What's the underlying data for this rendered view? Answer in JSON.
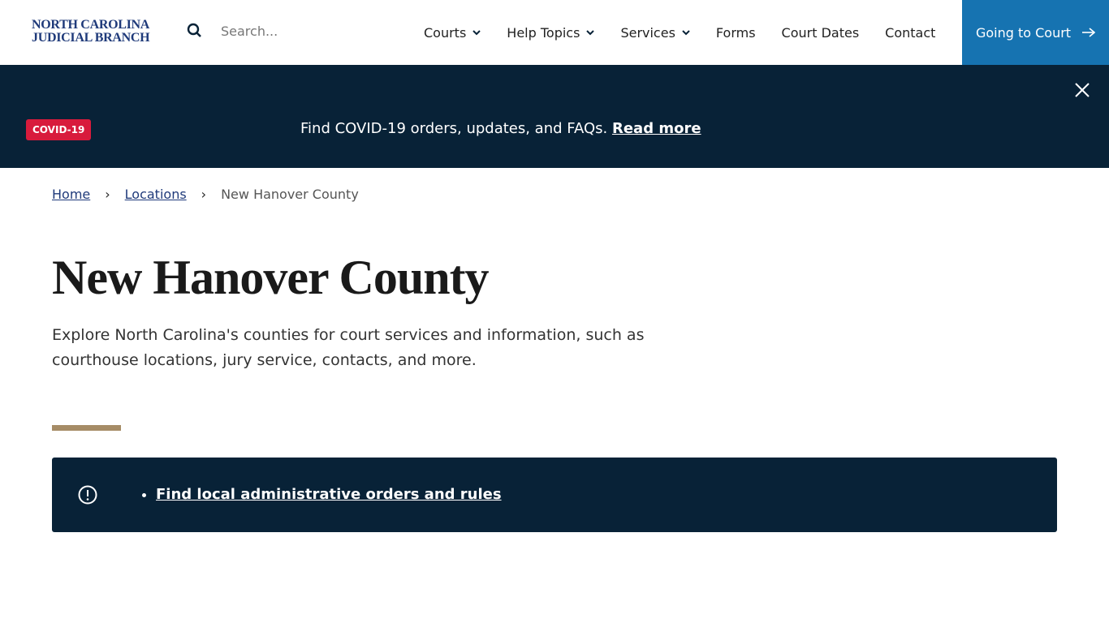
{
  "header": {
    "logo_line1": "NORTH CAROLINA",
    "logo_line2": "JUDICIAL BRANCH",
    "search_placeholder": "Search...",
    "nav": [
      {
        "label": "Courts",
        "dropdown": true
      },
      {
        "label": "Help Topics",
        "dropdown": true
      },
      {
        "label": "Services",
        "dropdown": true
      },
      {
        "label": "Forms"
      },
      {
        "label": "Court Dates"
      },
      {
        "label": "Contact"
      }
    ],
    "cta": "Going to Court"
  },
  "banner": {
    "badge": "COVID-19",
    "message": "Find COVID-19 orders, updates, and FAQs.",
    "link": "Read more"
  },
  "breadcrumb": [
    "Home",
    "Locations",
    "New Hanover County"
  ],
  "main": {
    "title": "New Hanover County",
    "lead": "Explore North Carolina's counties for court services and information, such as courthouse locations, jury service, contacts, and more.",
    "alert_link": "Find local administrative orders and rules"
  },
  "colors": {
    "navy": "#082237",
    "accent": "#1673b1",
    "badge": "#d81b3c",
    "rule": "#a68c66"
  }
}
